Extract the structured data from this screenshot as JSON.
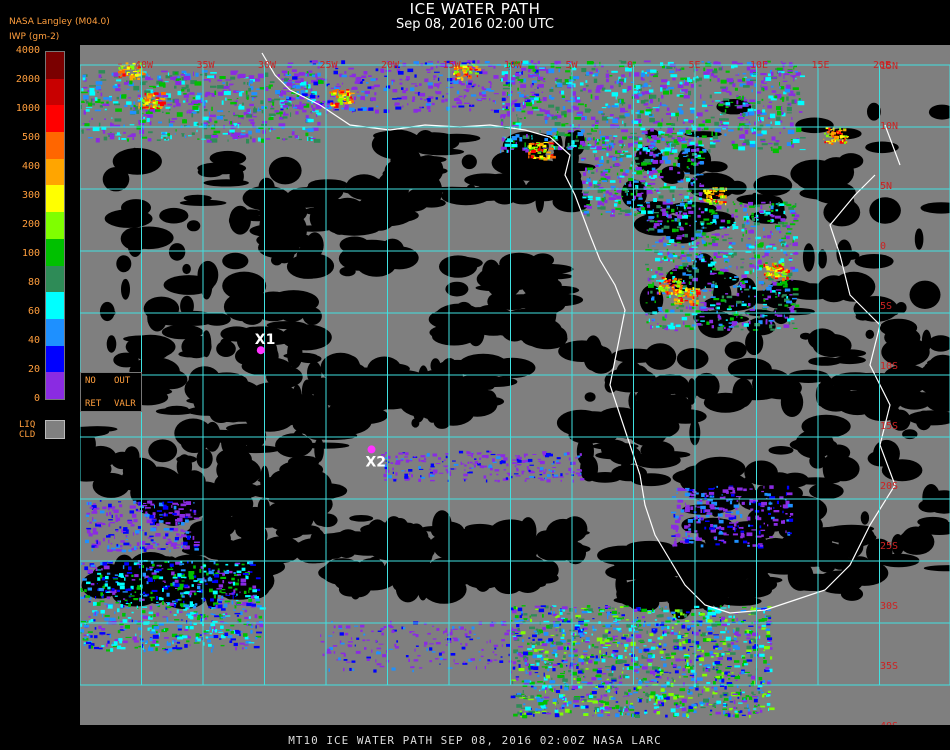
{
  "header": {
    "title": "ICE WATER PATH",
    "subtitle": "Sep 08, 2016 02:00 UTC",
    "agency": "NASA Langley (M04.0)",
    "units": "IWP (gm-2)"
  },
  "legend": {
    "ticks": [
      "4000",
      "2000",
      "1000",
      "500",
      "400",
      "300",
      "200",
      "100",
      "80",
      "60",
      "40",
      "20",
      "0"
    ],
    "colors": [
      "#7a0000",
      "#c80000",
      "#ff0000",
      "#ff6600",
      "#ffa500",
      "#ffff00",
      "#7fff00",
      "#00c000",
      "#2e8b57",
      "#00ffff",
      "#1e90ff",
      "#0000ff",
      "#8a2be2"
    ],
    "liq_label_1": "LIQ",
    "liq_label_2": "CLD",
    "liq_color": "#808080",
    "nodata_no": "NO",
    "nodata_out": "OUT",
    "nodata_ret": "RET",
    "nodata_valr": "VALR"
  },
  "map": {
    "grid_color": "#40e0e0",
    "coast_color": "#ffffff",
    "label_color": "#cc2222",
    "lon_labels": [
      "40W",
      "35W",
      "30W",
      "25W",
      "20W",
      "15W",
      "10W",
      "5W",
      "0",
      "5E",
      "10E",
      "15E",
      "20E"
    ],
    "lat_labels": [
      "15N",
      "10N",
      "5N",
      "0",
      "5S",
      "10S",
      "15S",
      "20S",
      "25S",
      "30S",
      "35S",
      "40S"
    ],
    "markers": [
      {
        "label": "X1",
        "lon": -30.3,
        "lat": -8.0
      },
      {
        "label": "X2",
        "lon": -21.3,
        "lat": -16.0
      }
    ],
    "marker_color": "#ff33ff"
  },
  "footer": "MT10   ICE WATER PATH   SEP 08, 2016 02:00Z   NASA LARC"
}
